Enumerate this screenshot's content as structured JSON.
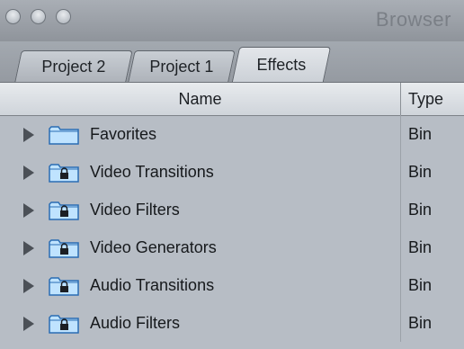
{
  "window": {
    "title": "Browser"
  },
  "tabs": [
    {
      "label": "Project 2"
    },
    {
      "label": "Project 1"
    },
    {
      "label": "Effects",
      "active": true
    }
  ],
  "columns": {
    "name": "Name",
    "type": "Type"
  },
  "rows": [
    {
      "label": "Favorites",
      "type": "Bin",
      "icon": "folder-icon"
    },
    {
      "label": "Video Transitions",
      "type": "Bin",
      "icon": "locked-folder-icon"
    },
    {
      "label": "Video Filters",
      "type": "Bin",
      "icon": "locked-folder-icon"
    },
    {
      "label": "Video Generators",
      "type": "Bin",
      "icon": "locked-folder-icon"
    },
    {
      "label": "Audio Transitions",
      "type": "Bin",
      "icon": "locked-folder-icon"
    },
    {
      "label": "Audio Filters",
      "type": "Bin",
      "icon": "locked-folder-icon"
    }
  ],
  "colors": {
    "background": "#b7bdc5",
    "folder_fill": "#bfe3ff",
    "folder_stroke": "#2a6db3"
  }
}
